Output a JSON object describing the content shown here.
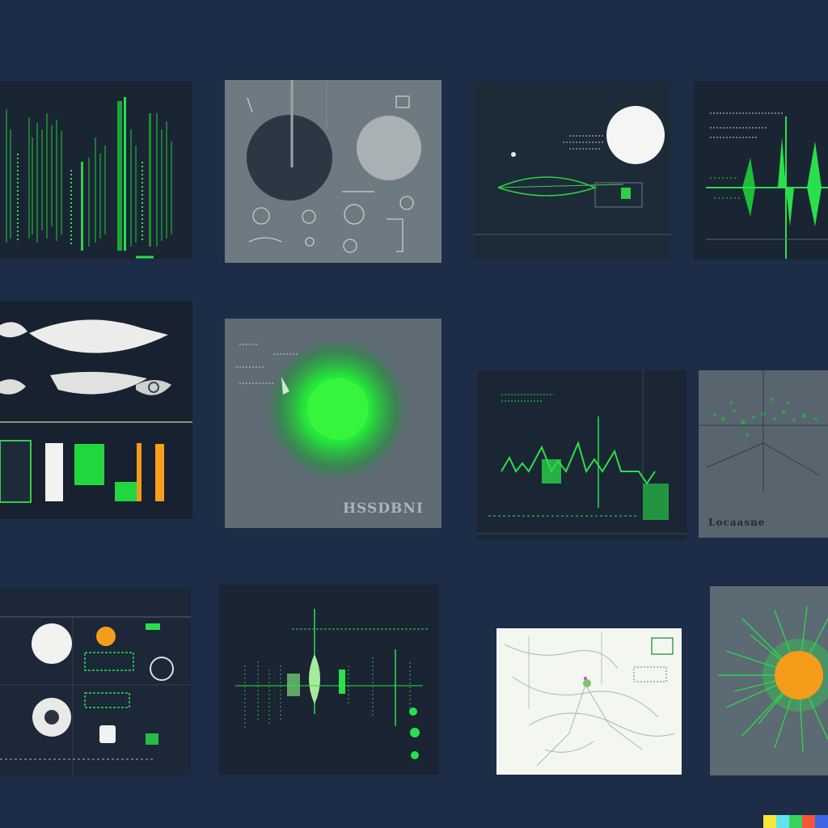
{
  "colors": {
    "background": "#1d2d47",
    "accent_green": "#22e63d",
    "accent_orange": "#f59c1a",
    "panel_dark": "#1a2533",
    "panel_gray": "#6d7a81"
  },
  "panels": [
    {
      "name": "green-bar-waveform"
    },
    {
      "name": "gray-circles-diagram"
    },
    {
      "name": "white-moon-signal"
    },
    {
      "name": "green-spike-signal"
    },
    {
      "name": "white-shapes-bars"
    },
    {
      "name": "green-radial-glow",
      "caption": "HSSDBNI"
    },
    {
      "name": "green-spike-chart"
    },
    {
      "name": "scatter-network",
      "caption": "Locaasne"
    },
    {
      "name": "dashboard-icons"
    },
    {
      "name": "green-lines-dots"
    },
    {
      "name": "sketch-map"
    },
    {
      "name": "orange-sunburst"
    }
  ],
  "signature_colors": [
    "#f5e83c",
    "#5fe3f0",
    "#37d35b",
    "#f3553a",
    "#3d66e6"
  ]
}
